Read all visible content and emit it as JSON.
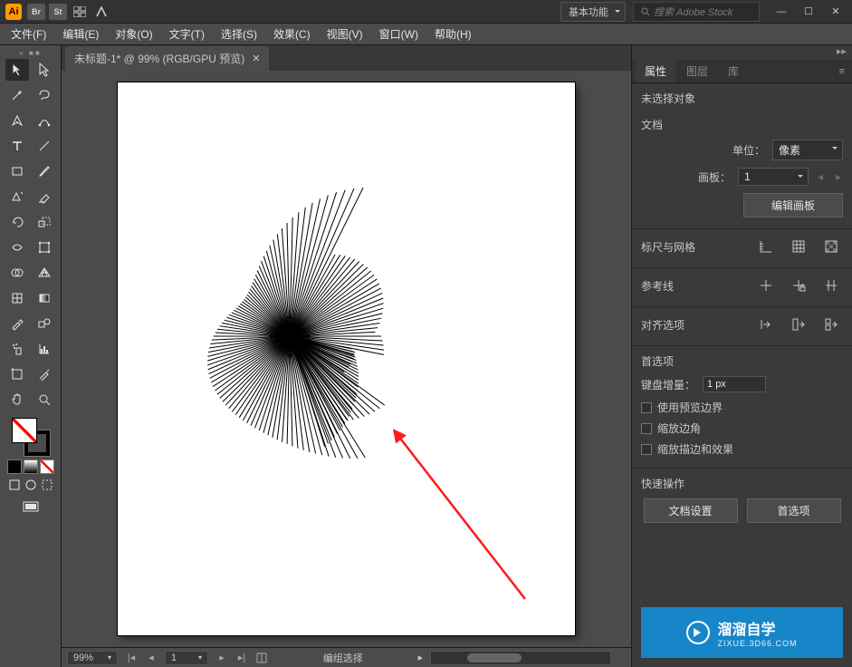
{
  "title_bar": {
    "app_badge": "Ai",
    "workspace": "基本功能",
    "search_placeholder": "搜索 Adobe Stock"
  },
  "menu": [
    "文件(F)",
    "编辑(E)",
    "对象(O)",
    "文字(T)",
    "选择(S)",
    "效果(C)",
    "视图(V)",
    "窗口(W)",
    "帮助(H)"
  ],
  "document": {
    "tab_label": "未标题-1* @ 99% (RGB/GPU 预览)"
  },
  "status": {
    "zoom": "99%",
    "artboard": "1",
    "mode": "编组选择"
  },
  "panel": {
    "tabs": [
      "属性",
      "图层",
      "库"
    ],
    "active": 0,
    "no_selection": "未选择对象",
    "doc_header": "文档",
    "unit_label": "单位：",
    "unit_value": "像素",
    "artboard_label": "画板：",
    "artboard_value": "1",
    "edit_artboard_btn": "编辑画板",
    "ruler_grid": "标尺与网格",
    "guides": "参考线",
    "align_opts": "对齐选项",
    "prefs_header": "首选项",
    "key_increment_label": "键盘增量：",
    "key_increment_value": "1 px",
    "chk_preview": "使用预览边界",
    "chk_scale_corners": "缩放边角",
    "chk_scale_strokes": "缩放描边和效果",
    "quick_header": "快速操作",
    "doc_setup_btn": "文档设置",
    "prefs_btn": "首选项"
  },
  "watermark": {
    "cn": "溜溜自学",
    "en": "ZIXUE.3D66.COM"
  }
}
